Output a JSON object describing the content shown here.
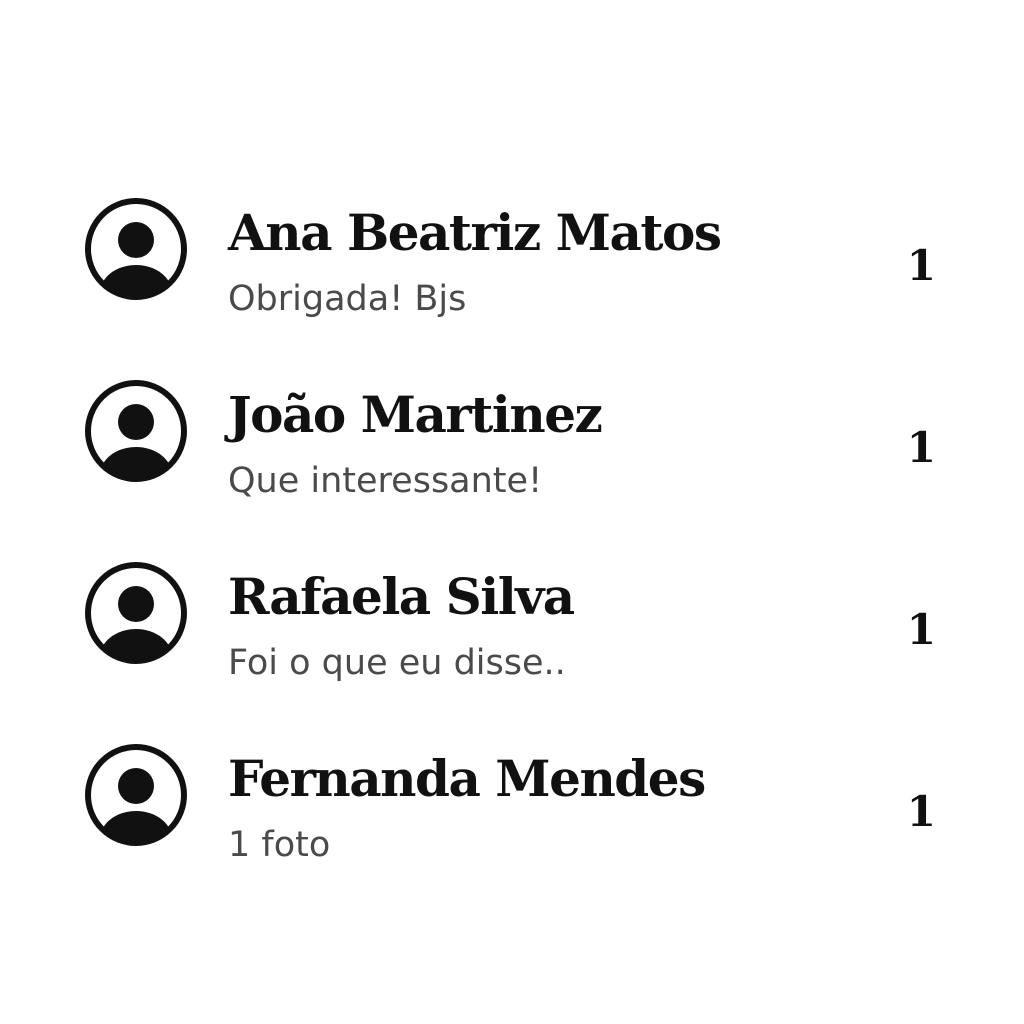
{
  "chats": [
    {
      "name": "Ana Beatriz Matos",
      "preview": "Obrigada! Bjs",
      "unread": "1",
      "avatar_icon": "user-avatar-icon"
    },
    {
      "name": "João Martinez",
      "preview": "Que interessante!",
      "unread": "1",
      "avatar_icon": "user-avatar-icon"
    },
    {
      "name": "Rafaela Silva",
      "preview": "Foi o que eu disse..",
      "unread": "1",
      "avatar_icon": "user-avatar-icon"
    },
    {
      "name": "Fernanda Mendes",
      "preview": "1 foto",
      "unread": "1",
      "avatar_icon": "user-avatar-icon"
    }
  ],
  "colors": {
    "text_primary": "#111111",
    "text_secondary": "#4a4a4a",
    "background": "#ffffff"
  }
}
